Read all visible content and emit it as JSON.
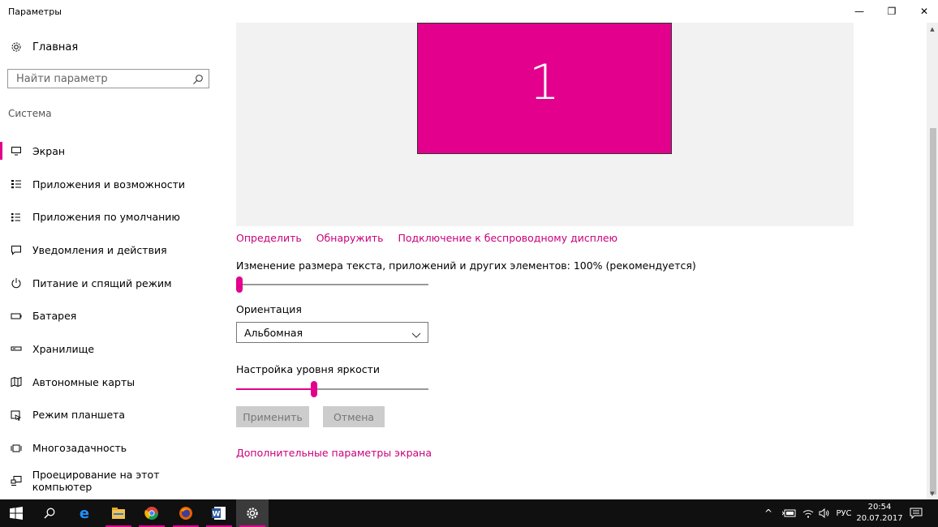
{
  "window": {
    "title": "Параметры",
    "minimize_glyph": "—",
    "maximize_glyph": "❐",
    "close_glyph": "✕"
  },
  "sidebar": {
    "home_label": "Главная",
    "search_placeholder": "Найти параметр",
    "section_label": "Система",
    "items": [
      {
        "label": "Экран",
        "icon": "monitor-icon",
        "active": true
      },
      {
        "label": "Приложения и возможности",
        "icon": "apps-list-icon"
      },
      {
        "label": "Приложения по умолчанию",
        "icon": "default-apps-icon"
      },
      {
        "label": "Уведомления и действия",
        "icon": "notifications-icon"
      },
      {
        "label": "Питание и спящий режим",
        "icon": "power-icon"
      },
      {
        "label": "Батарея",
        "icon": "battery-icon"
      },
      {
        "label": "Хранилище",
        "icon": "storage-icon"
      },
      {
        "label": "Автономные карты",
        "icon": "map-icon"
      },
      {
        "label": "Режим планшета",
        "icon": "tablet-icon"
      },
      {
        "label": "Многозадачность",
        "icon": "multitask-icon"
      },
      {
        "label": "Проецирование на этот компьютер",
        "icon": "project-icon"
      }
    ]
  },
  "main": {
    "monitor_number": "1",
    "links": [
      "Определить",
      "Обнаружить",
      "Подключение к беспроводному дисплею"
    ],
    "scale_label": "Изменение размера текста, приложений и других элементов: 100% (рекомендуется)",
    "scale_value_fraction": 0,
    "orientation_label": "Ориентация",
    "orientation_value": "Альбомная",
    "brightness_label": "Настройка уровня яркости",
    "brightness_fraction": 0.4,
    "apply_label": "Применить",
    "cancel_label": "Отмена",
    "advanced_link": "Дополнительные параметры экрана"
  },
  "taskbar": {
    "apps": [
      "start-icon",
      "search-icon",
      "edge-icon",
      "file-explorer-icon",
      "chrome-icon",
      "firefox-icon",
      "word-icon",
      "settings-icon"
    ],
    "tray": {
      "chevron": "^",
      "language": "РУС",
      "time": "20:54",
      "date": "20.07.2017"
    }
  },
  "colors": {
    "accent": "#e3008c",
    "link": "#c8007b",
    "taskbar": "#101010"
  }
}
